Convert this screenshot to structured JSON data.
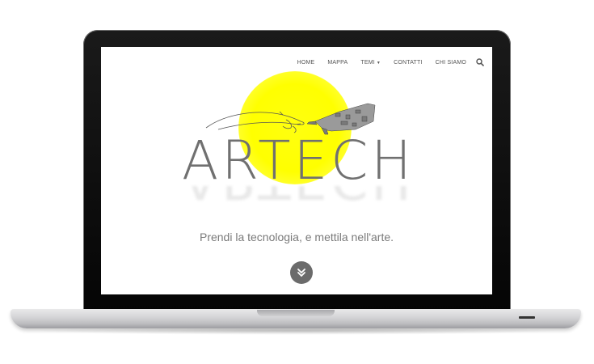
{
  "nav": {
    "items": [
      {
        "label": "HOME"
      },
      {
        "label": "MAPPA"
      },
      {
        "label": "TEMI",
        "has_dropdown": true
      },
      {
        "label": "CONTATTI"
      },
      {
        "label": "CHI SIAMO"
      }
    ],
    "search_icon": "search-icon"
  },
  "hero": {
    "logo": "ARTECH",
    "tagline": "Prendi la tecnologia, e mettila nell'arte.",
    "sun_color": "#ffff00",
    "scroll_icon": "chevron-double-down-icon"
  },
  "colors": {
    "text_gray": "#707070",
    "nav_text": "#555555",
    "button_bg": "#6b6b6b"
  }
}
